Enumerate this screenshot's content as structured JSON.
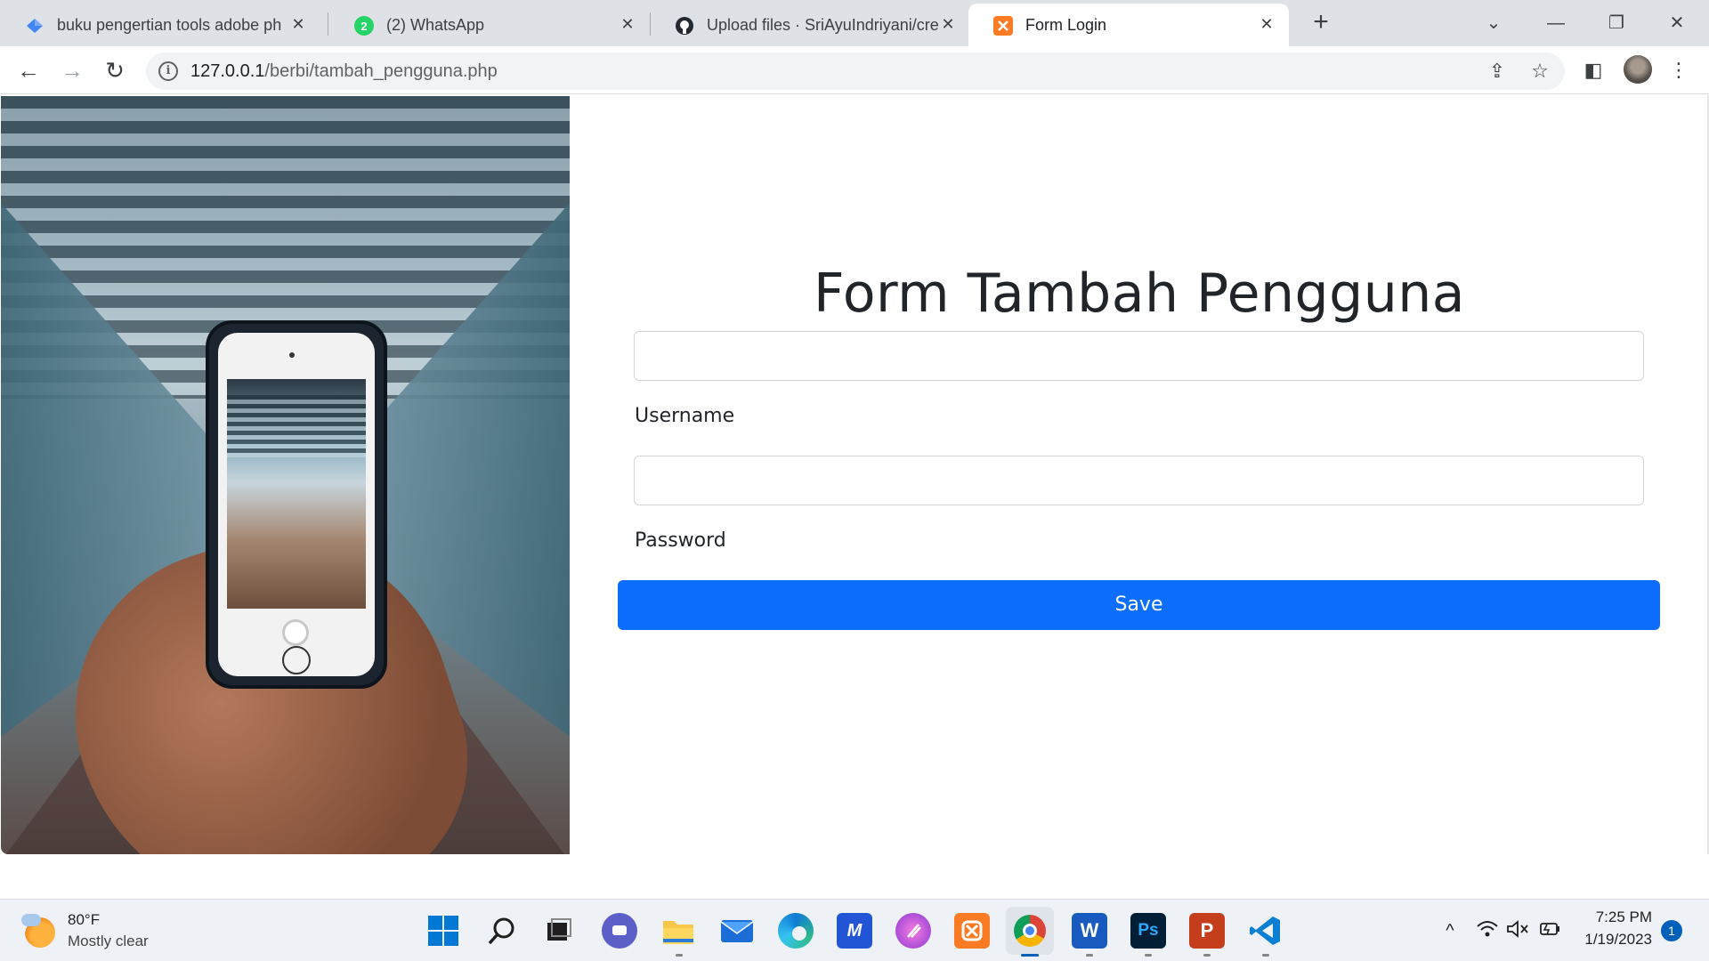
{
  "browser": {
    "tabs": [
      {
        "title": "buku pengertian tools adobe ph",
        "icon": "drive-icon",
        "close": "✕"
      },
      {
        "title": "(2) WhatsApp",
        "icon": "whatsapp-icon",
        "badge": "2",
        "close": "✕"
      },
      {
        "title": "Upload files · SriAyuIndriyani/cre",
        "icon": "github-icon",
        "close": "✕"
      },
      {
        "title": "Form Login",
        "icon": "xampp-icon",
        "close": "✕"
      }
    ],
    "new_tab": "+",
    "window_controls": {
      "tab_search": "⌄",
      "minimize": "—",
      "restore": "❐",
      "close": "✕"
    },
    "nav": {
      "back": "←",
      "forward": "→",
      "reload": "↻"
    },
    "address": {
      "host": "127.0.0.1",
      "path": "/berbi/tambah_pengguna.php"
    },
    "toolbar_icons": {
      "share": "⇪",
      "bookmark": "☆",
      "side_panel": "◧",
      "menu": "⋮"
    }
  },
  "page": {
    "title": "Form Tambah Pengguna",
    "username": {
      "label": "Username",
      "value": "",
      "placeholder": ""
    },
    "password": {
      "label": "Password",
      "value": "",
      "placeholder": ""
    },
    "save_label": "Save",
    "accent_color": "#0d6efd"
  },
  "taskbar": {
    "weather": {
      "temp": "80°F",
      "desc": "Mostly clear"
    },
    "apps": [
      "windows-start-icon",
      "search-icon",
      "task-view-icon",
      "teams-chat-icon",
      "file-explorer-icon",
      "mail-icon",
      "edge-icon",
      "vscode-alt-icon",
      "firefox-like-icon",
      "xampp-icon",
      "chrome-icon",
      "word-icon",
      "photoshop-icon",
      "powerpoint-icon",
      "vscode-icon"
    ],
    "tray": {
      "chevron": "^",
      "wifi": "◠",
      "volume": "🔇",
      "battery": "▭"
    },
    "clock": {
      "time": "7:25 PM",
      "date": "1/19/2023"
    },
    "notifications": "1"
  }
}
